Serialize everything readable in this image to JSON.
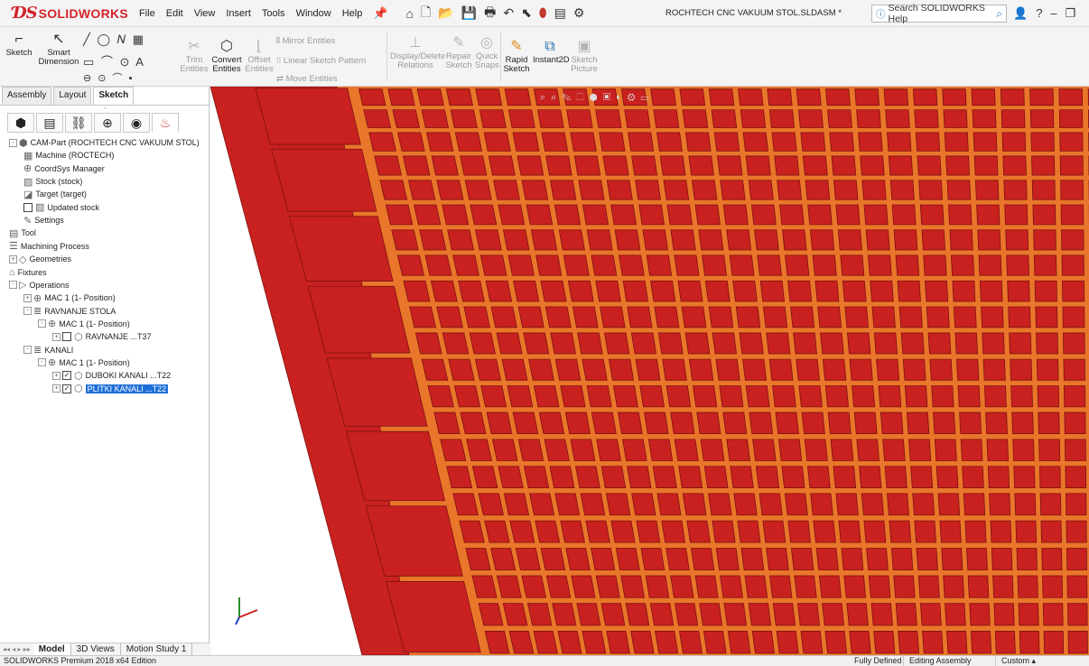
{
  "titlebar": {
    "logo_ds": "ƊS",
    "logo_text": "SOLIDWORKS",
    "menus": [
      "File",
      "Edit",
      "View",
      "Insert",
      "Tools",
      "Window",
      "Help"
    ],
    "document_title": "ROCHTECH CNC VAKUUM STOL.SLDASM *",
    "search_placeholder": "Search SOLIDWORKS Help",
    "help_symbol": "?"
  },
  "commands": {
    "sketch": "Sketch",
    "smart_dimension_1": "Smart",
    "smart_dimension_2": "Dimension",
    "trim_1": "Trim",
    "trim_2": "Entities",
    "convert_1": "Convert",
    "convert_2": "Entities",
    "offset_1": "Offset",
    "offset_2": "Entities",
    "mirror": "Mirror Entities",
    "linear_pattern": "Linear Sketch Pattern",
    "move": "Move Entities",
    "display_delete_1": "Display/Delete",
    "display_delete_2": "Relations",
    "repair_1": "Repair",
    "repair_2": "Sketch",
    "quick_snaps_1": "Quick",
    "quick_snaps_2": "Snaps",
    "rapid_1": "Rapid",
    "rapid_2": "Sketch",
    "instant2d": "Instant2D",
    "sketch_picture_1": "Sketch",
    "sketch_picture_2": "Picture"
  },
  "left_tabs": [
    "Assembly",
    "Layout",
    "Sketch"
  ],
  "tree": [
    {
      "label": "CAM-Part (ROCHTECH CNC VAKUUM STOL)",
      "indent": 0,
      "icon": "part-icon",
      "expander": "-"
    },
    {
      "label": "Machine (ROCTECH)",
      "indent": 1,
      "icon": "machine-icon"
    },
    {
      "label": "CoordSys Manager",
      "indent": 1,
      "icon": "coordsys-icon"
    },
    {
      "label": "Stock (stock)",
      "indent": 1,
      "icon": "stock-icon"
    },
    {
      "label": "Target (target)",
      "indent": 1,
      "icon": "target-icon"
    },
    {
      "label": "Updated stock",
      "indent": 1,
      "icon": "updated-stock-icon",
      "checkbox": ""
    },
    {
      "label": "Settings",
      "indent": 1,
      "icon": "settings-icon"
    },
    {
      "label": "Tool",
      "indent": 0,
      "icon": "tool-icon"
    },
    {
      "label": "Machining Process",
      "indent": 0,
      "icon": "process-icon"
    },
    {
      "label": "Geometries",
      "indent": 0,
      "icon": "geometries-icon",
      "expander": "+"
    },
    {
      "label": "Fixtures",
      "indent": 0,
      "icon": "fixtures-icon"
    },
    {
      "label": "Operations",
      "indent": 0,
      "icon": "operations-icon",
      "expander": "-"
    },
    {
      "label": "MAC 1 (1- Position)",
      "indent": 1,
      "icon": "mac-icon",
      "expander": "+"
    },
    {
      "label": "RAVNANJE STOLA",
      "indent": 1,
      "icon": "program-icon",
      "expander": "-"
    },
    {
      "label": "MAC 1 (1- Position)",
      "indent": 2,
      "icon": "mac-icon",
      "expander": "-"
    },
    {
      "label": "RAVNANJE ...T37",
      "indent": 3,
      "icon": "operation-icon",
      "expander": "+",
      "checkbox": ""
    },
    {
      "label": "KANALI",
      "indent": 1,
      "icon": "program-icon",
      "expander": "-"
    },
    {
      "label": "MAC 1 (1- Position)",
      "indent": 2,
      "icon": "mac-icon",
      "expander": "-"
    },
    {
      "label": "DUBOKI KANALI ...T22",
      "indent": 3,
      "icon": "operation-icon",
      "expander": "+",
      "checkbox": "☑"
    },
    {
      "label": "PLITKI KANALI ...T22",
      "indent": 3,
      "icon": "operation-icon",
      "expander": "+",
      "checkbox": "☑",
      "selected": true
    }
  ],
  "bottom_tabs": [
    "Model",
    "3D Views",
    "Motion Study 1"
  ],
  "status": {
    "edition": "SOLIDWORKS Premium 2018 x64 Edition",
    "fully_defined": "Fully Defined",
    "editing": "Editing Assembly",
    "units": "Custom"
  },
  "colors": {
    "brand": "#d2232a",
    "model_red": "#c8211f",
    "model_dark": "#7e1210",
    "groove": "#e9762a",
    "selection": "#1e6fd9"
  }
}
